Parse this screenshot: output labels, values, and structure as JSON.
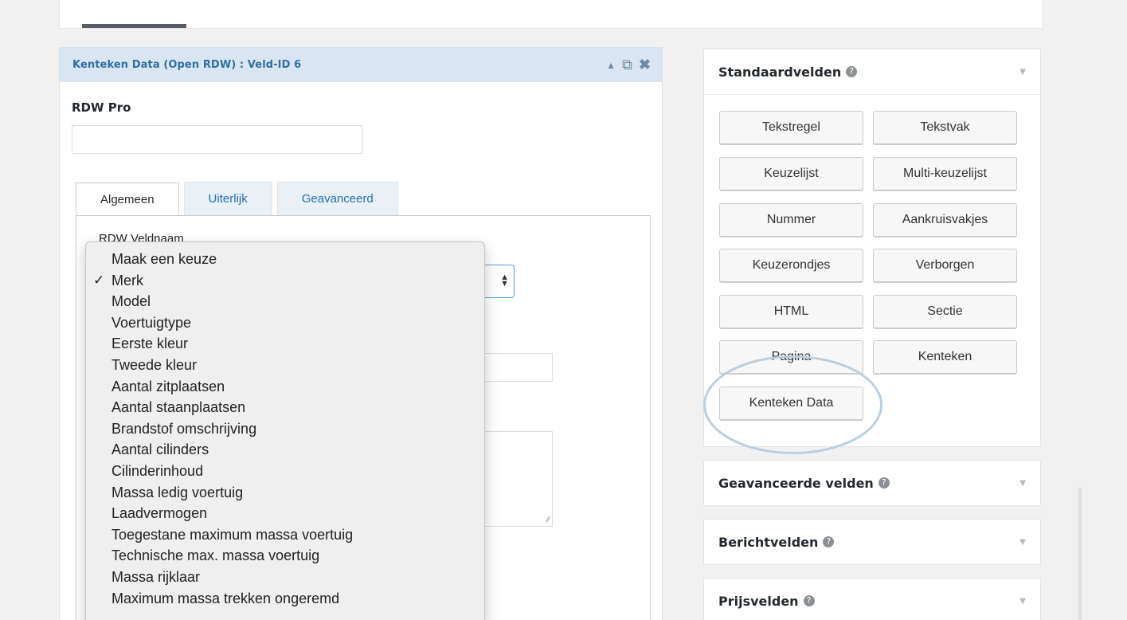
{
  "field": {
    "title": "Kenteken Data (Open RDW) : Veld-ID 6",
    "label": "RDW Pro",
    "tabs": [
      "Algemeen",
      "Uiterlijk",
      "Geavanceerd"
    ],
    "veldnaam_label": "RDW Veldnaam"
  },
  "dropdown": {
    "selected": "Merk",
    "options": [
      "Maak een keuze",
      "Merk",
      "Model",
      "Voertuigtype",
      "Eerste kleur",
      "Tweede kleur",
      "Aantal zitplaatsen",
      "Aantal staanplaatsen",
      "Brandstof omschrijving",
      "Aantal cilinders",
      "Cilinderinhoud",
      "Massa ledig voertuig",
      "Laadvermogen",
      "Toegestane maximum massa voertuig",
      "Technische max. massa voertuig",
      "Massa rijklaar",
      "Maximum massa trekken ongeremd"
    ]
  },
  "sidebar": {
    "standaard": {
      "title": "Standaardvelden",
      "buttons": [
        "Tekstregel",
        "Tekstvak",
        "Keuzelijst",
        "Multi-keuzelijst",
        "Nummer",
        "Aankruisvakjes",
        "Keuzerondjes",
        "Verborgen",
        "HTML",
        "Sectie",
        "Pagina",
        "Kenteken",
        "Kenteken Data"
      ]
    },
    "geavanceerd": {
      "title": "Geavanceerde velden"
    },
    "bericht": {
      "title": "Berichtvelden"
    },
    "prijs": {
      "title": "Prijsvelden"
    }
  },
  "colors": {
    "accent": "#2e6fa2",
    "header_bg": "#d9e6f1",
    "highlight_circle": "#b8cfe2"
  }
}
